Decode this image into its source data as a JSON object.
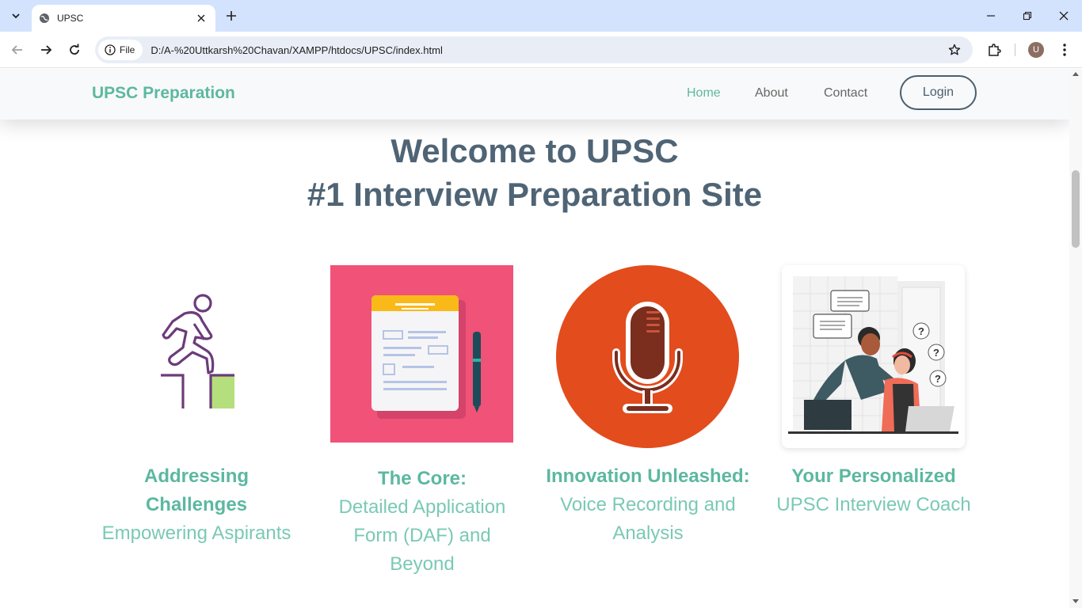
{
  "browser": {
    "tab_title": "UPSC",
    "file_chip_label": "File",
    "url": "D:/A-%20Uttkarsh%20Chavan/XAMPP/htdocs/UPSC/index.html",
    "profile_initial": "U"
  },
  "site": {
    "brand": "UPSC Preparation",
    "nav": {
      "home": "Home",
      "about": "About",
      "contact": "Contact",
      "login": "Login"
    },
    "hero": {
      "line1": "Welcome to UPSC",
      "line2": "#1 Interview Preparation Site"
    },
    "cards": [
      {
        "heading": "Addressing Challenges",
        "body": "Empowering Aspirants",
        "icon": "runner-climbing-steps-icon"
      },
      {
        "heading": "The Core:",
        "body": "Detailed Application Form (DAF) and Beyond",
        "icon": "clipboard-form-icon"
      },
      {
        "heading": "Innovation Unleashed:",
        "body": "Voice Recording and Analysis",
        "icon": "microphone-icon"
      },
      {
        "heading": "Your Personalized",
        "body": "UPSC Interview Coach",
        "icon": "coach-illustration"
      }
    ]
  },
  "colors": {
    "accent": "#5cb8a0",
    "hero_text": "#4f6475",
    "card1_bg": "#ffffff",
    "card2_bg": "#f05278",
    "card3_bg": "#e34c1d"
  }
}
